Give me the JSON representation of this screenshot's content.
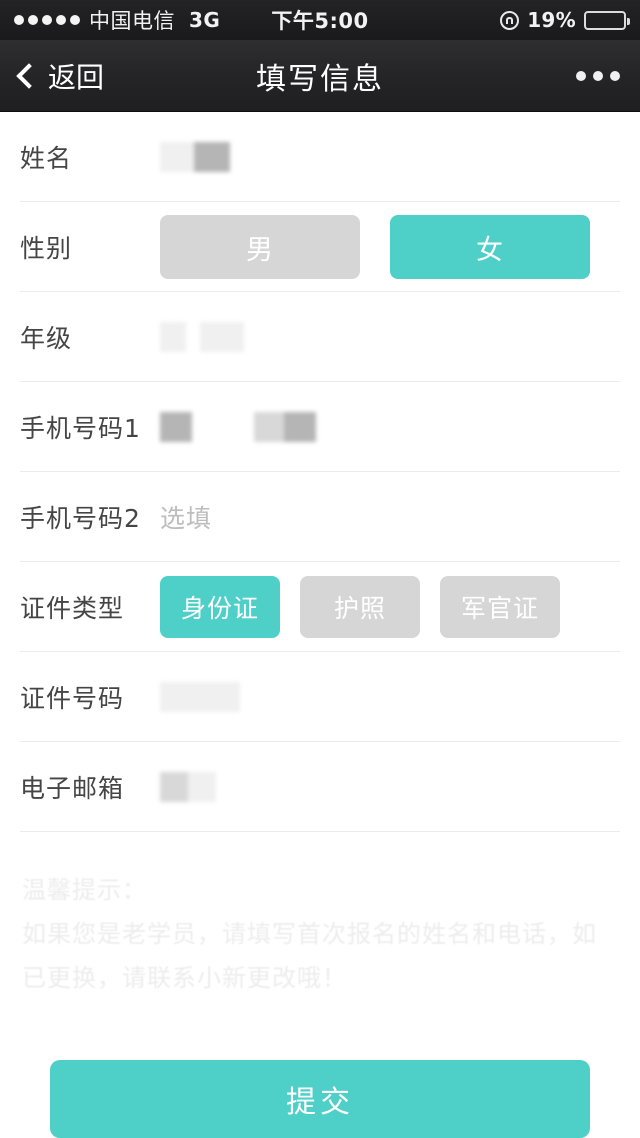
{
  "status_bar": {
    "signal_dots": 5,
    "carrier": "中国电信",
    "network": "3G",
    "time": "下午5:00",
    "battery_percent": "19%",
    "battery_level": 19,
    "battery_color": "#e8412f",
    "rotation_lock_icon": "rotation-lock-icon"
  },
  "nav": {
    "back_label": "返回",
    "title": "填写信息",
    "more_icon": "more-dots-icon"
  },
  "theme": {
    "accent": "#4ecfc8",
    "inactive": "#d6d6d6",
    "label_color": "#454545",
    "placeholder_color": "#bdbdbd",
    "divider": "#ececec",
    "navbar_bg": "#242426"
  },
  "form": {
    "rows": [
      {
        "label": "姓名",
        "type": "redacted"
      },
      {
        "label": "性别",
        "type": "options"
      },
      {
        "label": "年级",
        "type": "redacted"
      },
      {
        "label": "手机号码1",
        "type": "redacted"
      },
      {
        "label": "手机号码2",
        "type": "placeholder",
        "placeholder": "选填"
      },
      {
        "label": "证件类型",
        "type": "options"
      },
      {
        "label": "证件号码",
        "type": "redacted"
      },
      {
        "label": "电子邮箱",
        "type": "redacted"
      }
    ],
    "name_label": "姓名",
    "gender_label": "性别",
    "grade_label": "年级",
    "phone1_label": "手机号码1",
    "phone2_label": "手机号码2",
    "phone2_placeholder": "选填",
    "idtype_label": "证件类型",
    "idnumber_label": "证件号码",
    "email_label": "电子邮箱",
    "gender_options": [
      {
        "label": "男",
        "selected": false
      },
      {
        "label": "女",
        "selected": true
      }
    ],
    "idtype_options": [
      {
        "label": "身份证",
        "selected": true
      },
      {
        "label": "护照",
        "selected": false
      },
      {
        "label": "军官证",
        "selected": false
      }
    ]
  },
  "notice": {
    "title": "温馨提示：",
    "body": "如果您是老学员，请填写首次报名的姓名和电话，如已更换，请联系小新更改哦！"
  },
  "submit": {
    "label": "提交"
  }
}
